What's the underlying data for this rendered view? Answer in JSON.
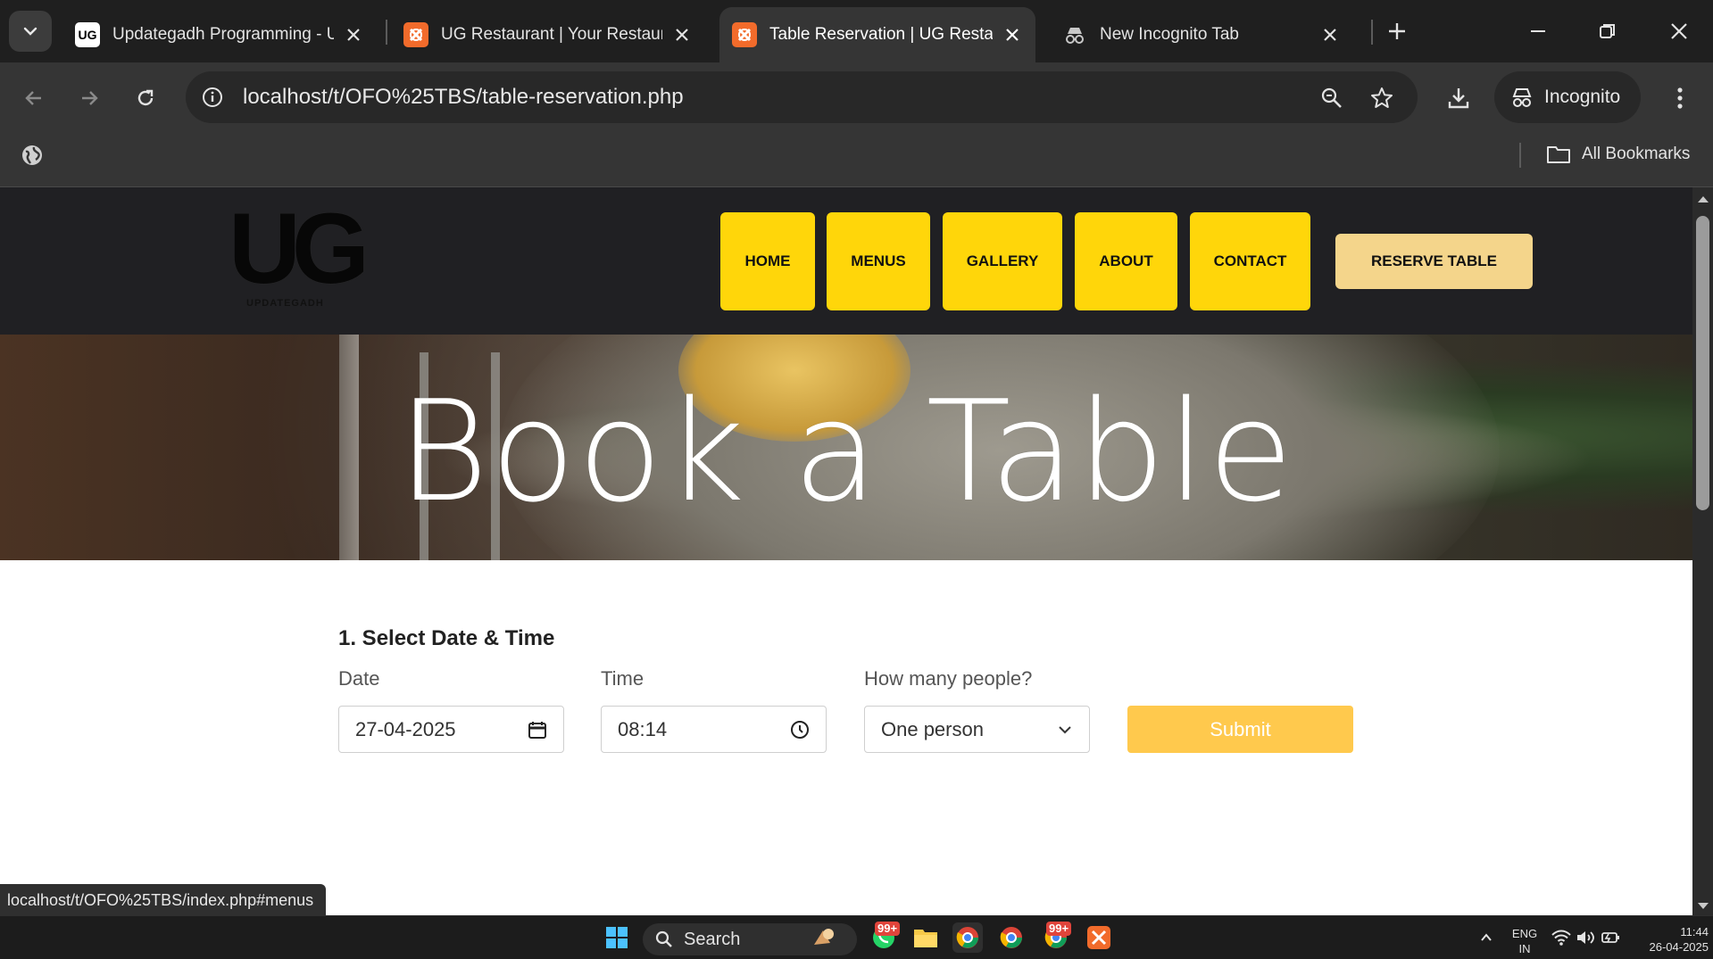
{
  "browser": {
    "tabs": [
      {
        "title": "Updategadh Programming - U",
        "favicon": "ug-logo-icon",
        "active": false
      },
      {
        "title": "UG Restaurant | Your Restaurant",
        "favicon": "xampp-icon",
        "active": false
      },
      {
        "title": "Table Reservation | UG Restaurant",
        "favicon": "xampp-icon",
        "active": true
      },
      {
        "title": "New Incognito Tab",
        "favicon": "incognito-icon",
        "active": false
      }
    ],
    "url": "localhost/t/OFO%25TBS/table-reservation.php",
    "profile_label": "Incognito",
    "bookmarks_label": "All Bookmarks",
    "status_url": "localhost/t/OFO%25TBS/index.php#menus"
  },
  "site": {
    "logo_text": "UG",
    "logo_sub": "UPDATEGADH",
    "nav": [
      "HOME",
      "MENUS",
      "GALLERY",
      "ABOUT",
      "CONTACT"
    ],
    "reserve_label": "RESERVE TABLE",
    "hero_title": "Book a Table"
  },
  "form": {
    "step_title": "1. Select Date & Time",
    "date_label": "Date",
    "date_value": "27-04-2025",
    "time_label": "Time",
    "time_value": "08:14",
    "people_label": "How many people?",
    "people_value": "One person",
    "submit_label": "Submit"
  },
  "taskbar": {
    "search_label": "Search",
    "badge_whatsapp": "99+",
    "badge_chrome": "99+",
    "lang_top": "ENG",
    "lang_bottom": "IN",
    "time": "11:44",
    "date": "26-04-2025"
  },
  "colors": {
    "nav_yellow": "#ffd60a",
    "reserve_bg": "#f4d58b",
    "submit_bg": "#ffc94d",
    "header_bg": "#202023"
  }
}
